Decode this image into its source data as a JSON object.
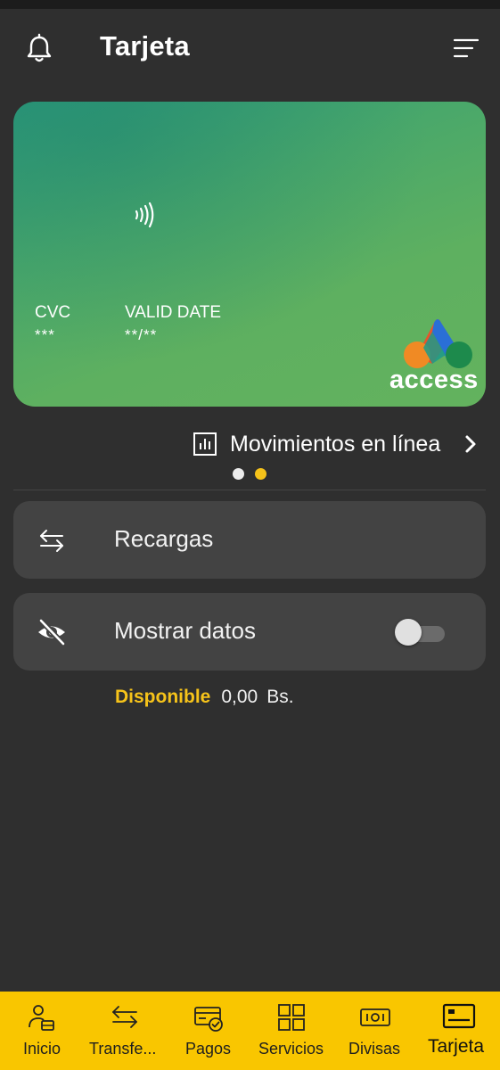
{
  "header": {
    "title": "Tarjeta"
  },
  "card": {
    "cvc_label": "CVC",
    "cvc_value": "***",
    "valid_label": "VALID DATE",
    "valid_value": "**/**",
    "brand": "access"
  },
  "movimientos": {
    "label": "Movimientos en línea"
  },
  "carousel": {
    "page_count": 2,
    "active_index": 1
  },
  "rows": {
    "recargas": "Recargas",
    "mostrar": "Mostrar datos",
    "mostrar_toggle_on": false
  },
  "balance": {
    "label": "Disponible",
    "amount": "0,00",
    "currency": "Bs."
  },
  "bottom_nav": {
    "items": [
      {
        "label": "Inicio",
        "icon": "home-lock-icon"
      },
      {
        "label": "Transfe...",
        "icon": "transfer-arrows-icon"
      },
      {
        "label": "Pagos",
        "icon": "payment-card-check-icon"
      },
      {
        "label": "Servicios",
        "icon": "grid-icon"
      },
      {
        "label": "Divisas",
        "icon": "banknote-icon"
      },
      {
        "label": "Tarjeta",
        "icon": "card-icon"
      }
    ],
    "active_index": 5
  },
  "colors": {
    "background": "#2f2f2f",
    "accent": "#f6c31a",
    "nav_bar": "#f9c600",
    "row_card": "#434343"
  }
}
